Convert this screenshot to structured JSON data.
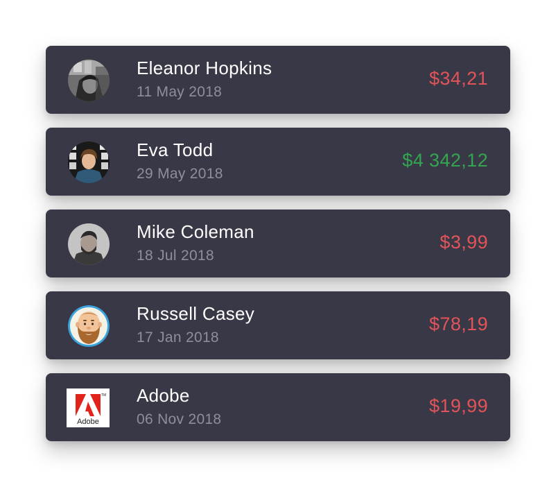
{
  "transactions": [
    {
      "name": "Eleanor Hopkins",
      "date": "11 May 2018",
      "amount": "$34,21",
      "direction": "negative",
      "avatar_icon": "user-photo"
    },
    {
      "name": "Eva Todd",
      "date": "29 May 2018",
      "amount": "$4 342,12",
      "direction": "positive",
      "avatar_icon": "user-photo"
    },
    {
      "name": "Mike Coleman",
      "date": "18 Jul 2018",
      "amount": "$3,99",
      "direction": "negative",
      "avatar_icon": "user-photo"
    },
    {
      "name": "Russell Casey",
      "date": "17 Jan 2018",
      "amount": "$78,19",
      "direction": "negative",
      "avatar_icon": "bearded-man-illustration"
    },
    {
      "name": "Adobe",
      "date": "06 Nov 2018",
      "amount": "$19,99",
      "direction": "negative",
      "avatar_icon": "adobe-logo",
      "logo_text": "Adobe"
    }
  ],
  "colors": {
    "card_background": "#393846",
    "name_text": "#ffffff",
    "date_text": "#8f8e9a",
    "amount_negative": "#e0545a",
    "amount_positive": "#33a550",
    "adobe_red": "#e2231a"
  }
}
